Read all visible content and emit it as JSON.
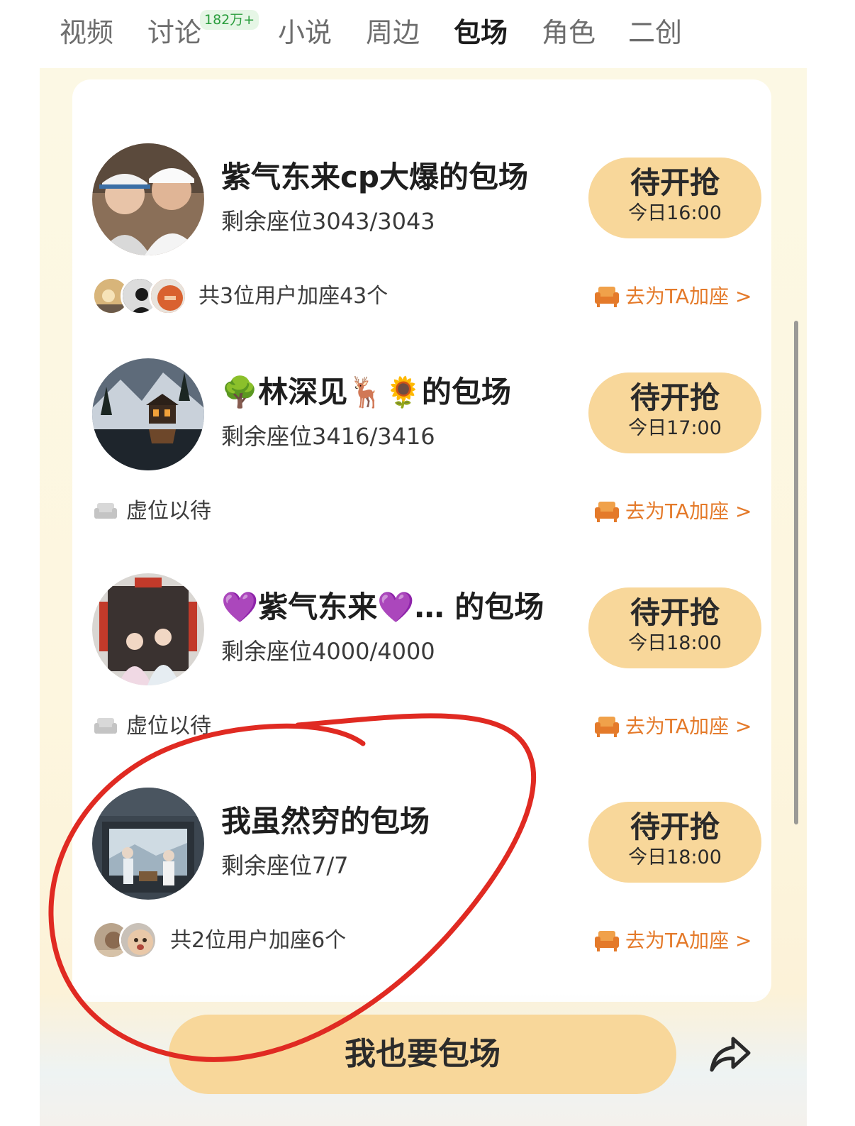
{
  "tabs": [
    {
      "label": "视频",
      "active": false
    },
    {
      "label": "讨论",
      "active": false,
      "badge": "182万+"
    },
    {
      "label": "小说",
      "active": false
    },
    {
      "label": "周边",
      "active": false
    },
    {
      "label": "包场",
      "active": true
    },
    {
      "label": "角色",
      "active": false
    },
    {
      "label": "二创",
      "active": false
    }
  ],
  "cards": [
    {
      "title": "紫气东来cp大爆的包场",
      "seats": "剩余座位3043/3043",
      "grab_label": "待开抢",
      "grab_time": "今日16:00",
      "users_text": "共3位用户加座43个",
      "add_seat_label": "去为TA加座 >"
    },
    {
      "title": "🌳林深见🦌🌻的包场",
      "seats": "剩余座位3416/3416",
      "grab_label": "待开抢",
      "grab_time": "今日17:00",
      "empty_text": "虚位以待",
      "add_seat_label": "去为TA加座 >"
    },
    {
      "title": "💜紫气东来💜… 的包场",
      "seats": "剩余座位4000/4000",
      "grab_label": "待开抢",
      "grab_time": "今日18:00",
      "empty_text": "虚位以待",
      "add_seat_label": "去为TA加座 >"
    },
    {
      "title": "我虽然穷的包场",
      "seats": "剩余座位7/7",
      "grab_label": "待开抢",
      "grab_time": "今日18:00",
      "users_text": "共2位用户加座6个",
      "add_seat_label": "去为TA加座 >"
    }
  ],
  "bottom": {
    "main_button_label": "我也要包场",
    "share_icon": "share-arrow-icon"
  },
  "colors": {
    "accent_button": "#f8d79a",
    "add_seat_text": "#e47a2a",
    "badge_green": "#2a9d3d",
    "annotation_red": "#e02a22"
  }
}
